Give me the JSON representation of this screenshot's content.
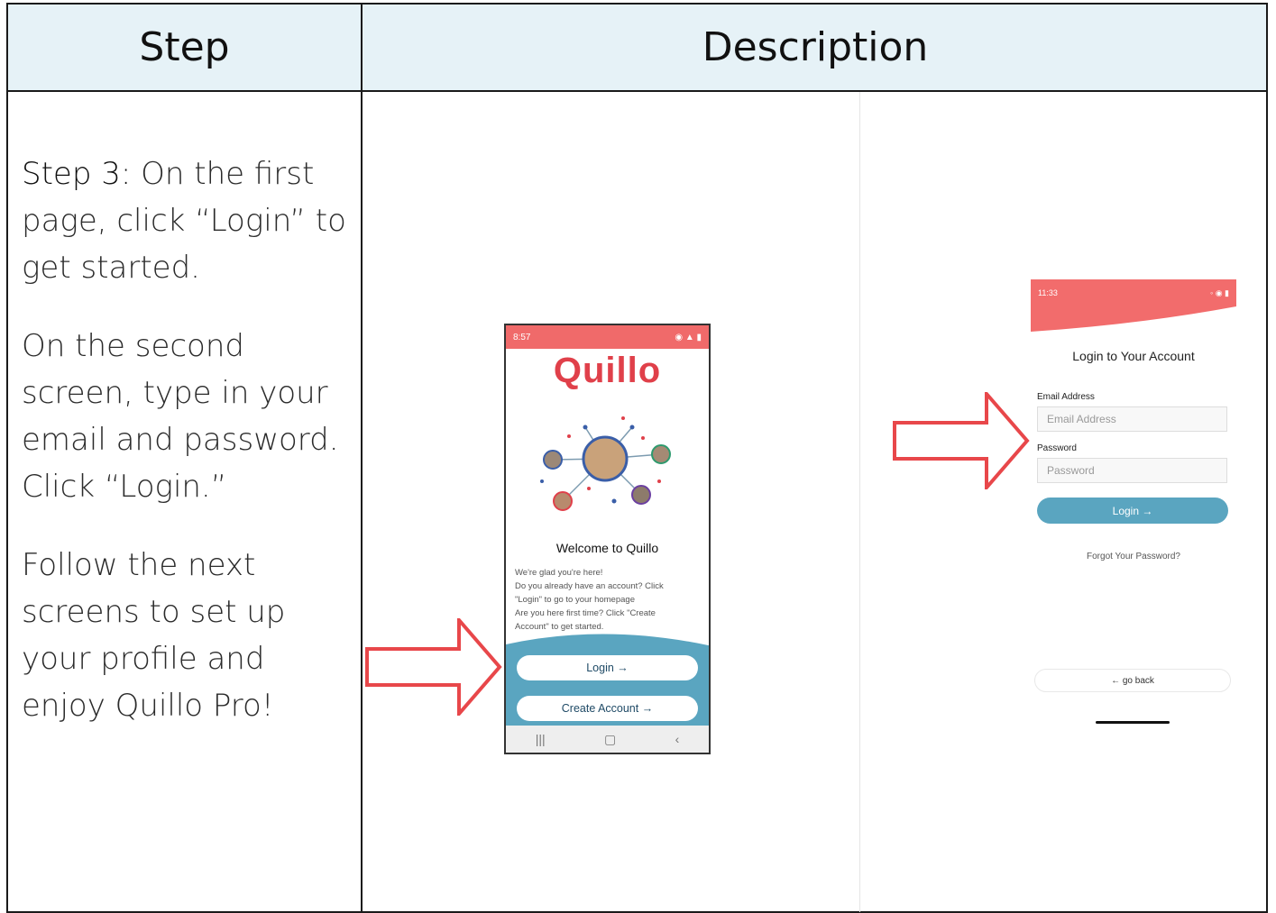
{
  "header": {
    "step": "Step",
    "description": "Description"
  },
  "instructions": {
    "step_label": "Step 3:",
    "line1": " On the first page, click “Login” to get started.",
    "line2": "On the second screen, type in your email and password. Click “Login.”",
    "line3": "Follow the next screens to set up your profile and enjoy Quillo Pro!"
  },
  "phone1": {
    "time": "8:57",
    "logo": "Quillo",
    "title": "Welcome to Quillo",
    "body": [
      "We're glad you're here!",
      "Do you already have an account? Click",
      "\"Login\" to go to your homepage",
      "Are you here first time? Click \"Create",
      "Account\" to get started."
    ],
    "login_button": "Login →",
    "create_button": "Create Account →",
    "nav": [
      "|||",
      "▢",
      "‹"
    ]
  },
  "phone2": {
    "time": "11:33",
    "title": "Login to Your Account",
    "email_label": "Email Address",
    "email_placeholder": "Email Address",
    "password_label": "Password",
    "password_placeholder": "Password",
    "login_button": "Login →",
    "forgot": "Forgot Your Password?",
    "back_button": "← go back"
  },
  "colors": {
    "arrow": "#e8474a",
    "brand_red": "#e0404a",
    "accent_blue": "#5aa5c0"
  }
}
